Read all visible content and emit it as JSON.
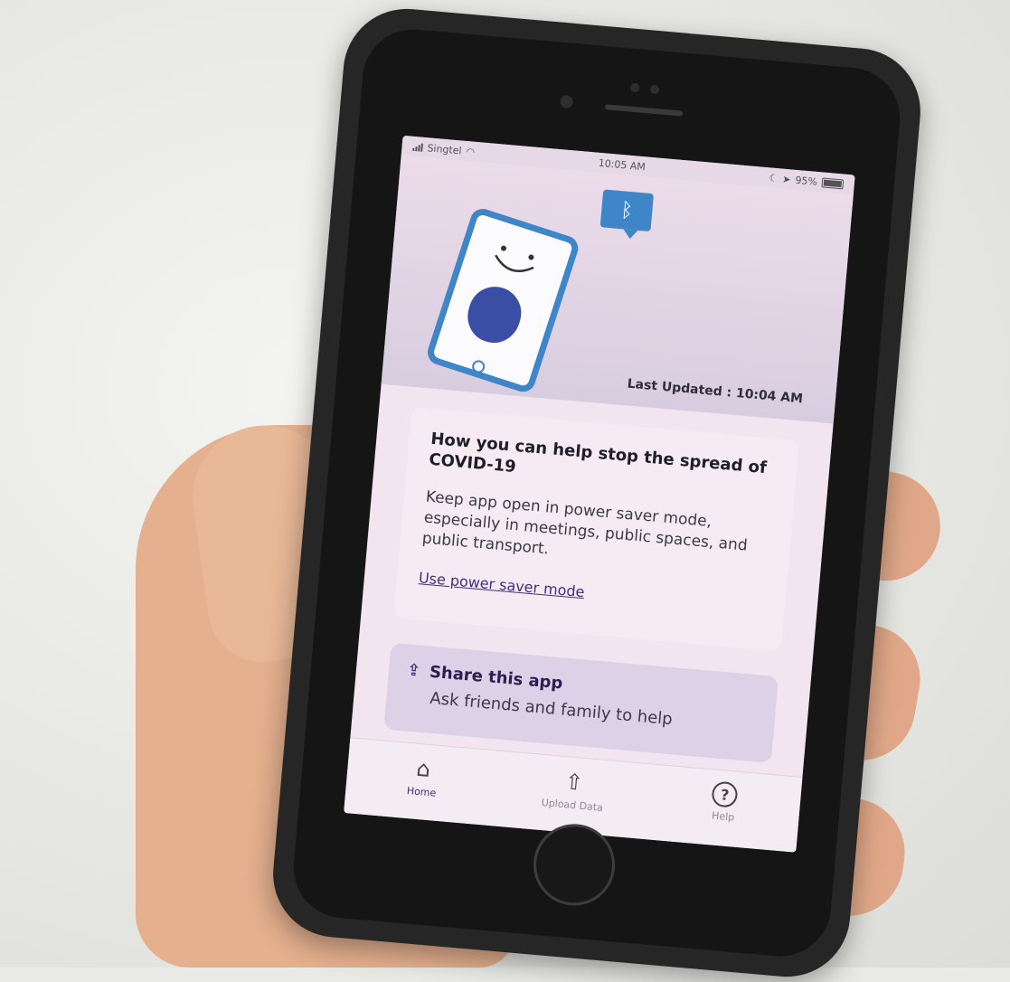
{
  "status_bar": {
    "carrier": "Singtel",
    "time": "10:05 AM",
    "battery": "95%"
  },
  "hero": {
    "bluetooth_symbol": "ᛒ",
    "last_updated": "Last Updated : 10:04 AM"
  },
  "info_card": {
    "title": "How you can help stop the spread of COVID-19",
    "body": "Keep app open in power saver mode, especially in meetings, public spaces, and public transport.",
    "link": "Use power saver mode"
  },
  "share_card": {
    "title": "Share this app",
    "subtitle": "Ask friends and family to help"
  },
  "tabs": [
    {
      "label": "Home",
      "icon": "home-icon",
      "active": true
    },
    {
      "label": "Upload Data",
      "icon": "upload-icon",
      "active": false
    },
    {
      "label": "Help",
      "icon": "help-icon",
      "active": false
    }
  ],
  "colors": {
    "accent": "#3f2f7c",
    "bluetooth_blue": "#3f86c9",
    "shield_navy": "#3b4ea6"
  }
}
